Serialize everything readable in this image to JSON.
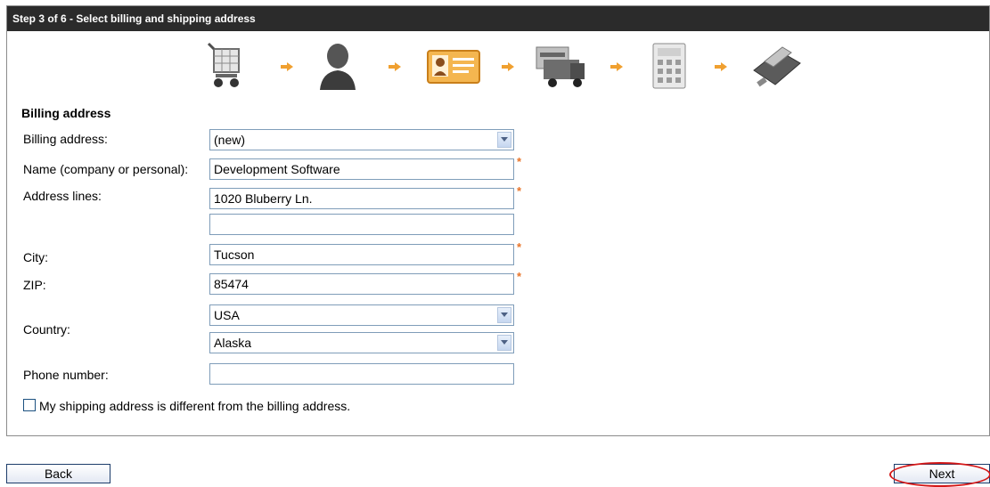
{
  "header": {
    "title": "Step 3 of 6 - Select billing and shipping address"
  },
  "steps": [
    {
      "icon": "cart-icon"
    },
    {
      "icon": "person-icon"
    },
    {
      "icon": "contact-card-icon"
    },
    {
      "icon": "delivery-truck-icon"
    },
    {
      "icon": "calculator-icon"
    },
    {
      "icon": "credit-card-reader-icon"
    }
  ],
  "form": {
    "section_title": "Billing address",
    "billing_address": {
      "label": "Billing address:",
      "value": "(new)"
    },
    "name": {
      "label": "Name (company or personal):",
      "value": "Development Software"
    },
    "address": {
      "label": "Address lines:",
      "line1": "1020 Bluberry Ln.",
      "line2": ""
    },
    "city": {
      "label": "City:",
      "value": "Tucson"
    },
    "zip": {
      "label": "ZIP:",
      "value": "85474"
    },
    "country": {
      "label": "Country:",
      "value": "USA",
      "state": "Alaska"
    },
    "phone": {
      "label": "Phone number:",
      "value": ""
    },
    "required_marker": "*",
    "shipping_checkbox": {
      "label": "My shipping address is different from the billing address.",
      "checked": false
    }
  },
  "buttons": {
    "back": "Back",
    "next": "Next"
  },
  "colors": {
    "titlebar": "#2b2b2b",
    "required": "#e8752a",
    "highlight": "#d41818",
    "field_border": "#7f9db9"
  }
}
